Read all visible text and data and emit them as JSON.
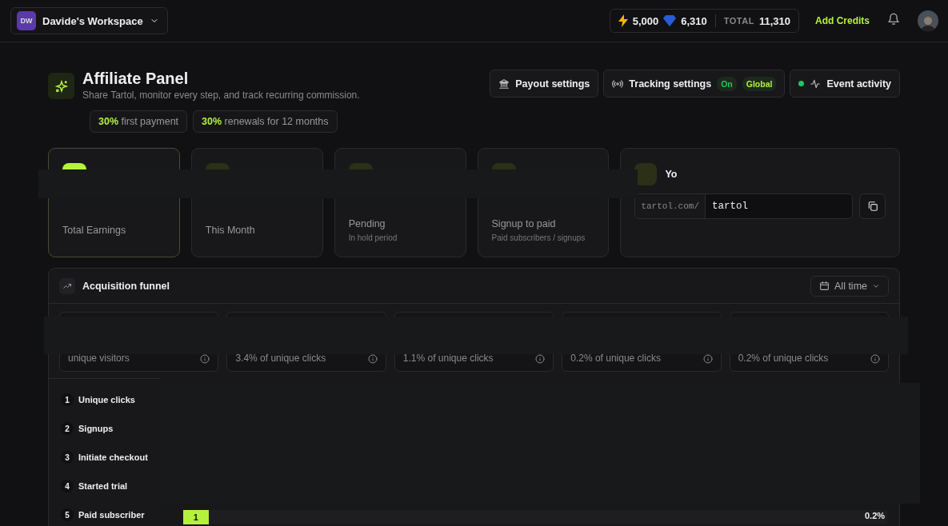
{
  "workspace": {
    "initials": "DW",
    "name": "Davide's Workspace"
  },
  "credits": {
    "bolts": "5,000",
    "gems": "6,310",
    "total_label": "TOTAL",
    "total": "11,310",
    "add": "Add Credits"
  },
  "header": {
    "title": "Affiliate Panel",
    "subtitle": "Share Tartol, monitor every step, and track recurring commission.",
    "badges": [
      {
        "strong": "30%",
        "text": "first payment"
      },
      {
        "strong": "30%",
        "text": "renewals for 12 months"
      }
    ]
  },
  "actions": [
    {
      "kind": "payout",
      "label": "Payout settings"
    },
    {
      "kind": "tracking",
      "label": "Tracking settings",
      "tags": [
        {
          "text": "On",
          "color": "#22c55e"
        },
        {
          "text": "Global",
          "color": "#b5f23d"
        }
      ]
    },
    {
      "kind": "activity",
      "label": "Event activity",
      "color": "#22c55e"
    }
  ],
  "stats": [
    {
      "label": "Total Earnings",
      "selected": true
    },
    {
      "label": "This Month",
      "selected": false
    },
    {
      "label": "Pending",
      "note": "In hold period",
      "selected": false
    },
    {
      "label": "Signup to paid",
      "note": "Paid subscribers / signups",
      "selected": false
    }
  ],
  "link": {
    "title": "Yo",
    "prefix": "tartol.com/",
    "value": "tartol"
  },
  "funnel": {
    "title": "Acquisition funnel",
    "range": "All time",
    "metrics": [
      "unique visitors",
      "3.4% of unique clicks",
      "1.1% of unique clicks",
      "0.2% of unique clicks",
      "0.2% of unique clicks"
    ],
    "steps": [
      {
        "number": "1",
        "label": "Unique clicks"
      },
      {
        "number": "2",
        "label": "Signups"
      },
      {
        "number": "3",
        "label": "Initiate checkout"
      },
      {
        "number": "4",
        "label": "Started trial"
      },
      {
        "number": "5",
        "label": "Paid subscriber",
        "value": "1",
        "share": "0.2%",
        "level": 0.036
      }
    ]
  }
}
